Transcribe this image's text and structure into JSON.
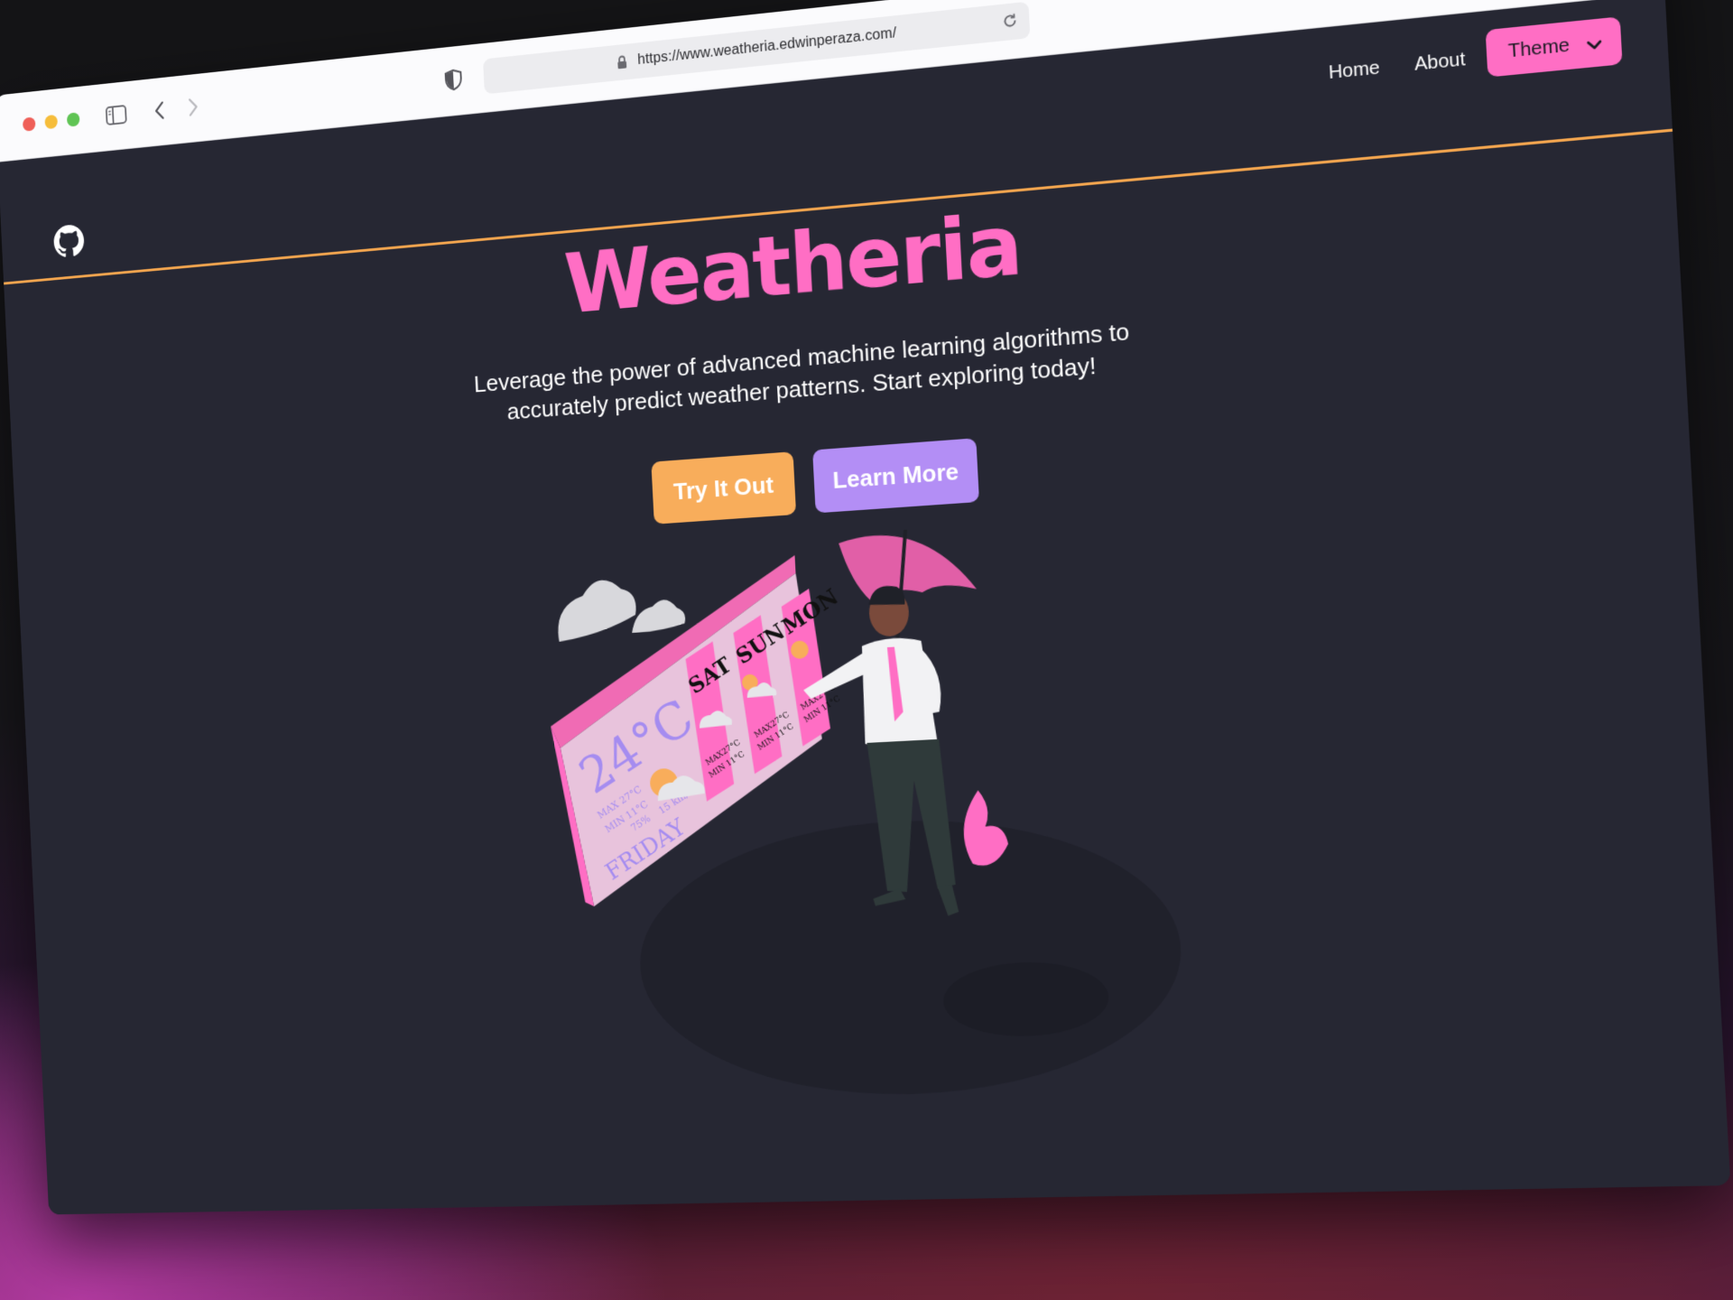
{
  "browser": {
    "url": "https://www.weatheria.edwinperaza.com/"
  },
  "nav": {
    "home": "Home",
    "about": "About",
    "theme": "Theme"
  },
  "hero": {
    "title": "Weatheria",
    "subtitle": "Leverage the power of advanced machine learning algorithms to accurately predict weather patterns. Start exploring today!",
    "try_label": "Try It Out",
    "learn_label": "Learn More"
  },
  "illustration": {
    "today_temp": "24°C",
    "today_max": "MAX 27°C",
    "today_min": "MIN 11°C",
    "humidity": "75%",
    "wind": "15 km/h",
    "today_day": "FRIDAY",
    "forecast": [
      {
        "day": "SAT",
        "max": "MAX27°C",
        "min": "MIN 11°C"
      },
      {
        "day": "SUN",
        "max": "MAX27°C",
        "min": "MIN 11°C"
      },
      {
        "day": "MON",
        "max": "MAX27°C",
        "min": "MIN 11°C"
      }
    ]
  },
  "colors": {
    "accent_pink": "#ff6ec4",
    "accent_orange": "#f8ad5b",
    "accent_purple": "#b38ef5",
    "page_bg": "#262733",
    "divider": "#f4a64f"
  },
  "icons": [
    "github-icon",
    "sidebar-icon",
    "back-icon",
    "forward-icon",
    "shield-icon",
    "lock-icon",
    "reload-icon",
    "download-icon",
    "share-icon",
    "plus-icon",
    "tabs-icon",
    "chevron-down-icon"
  ]
}
